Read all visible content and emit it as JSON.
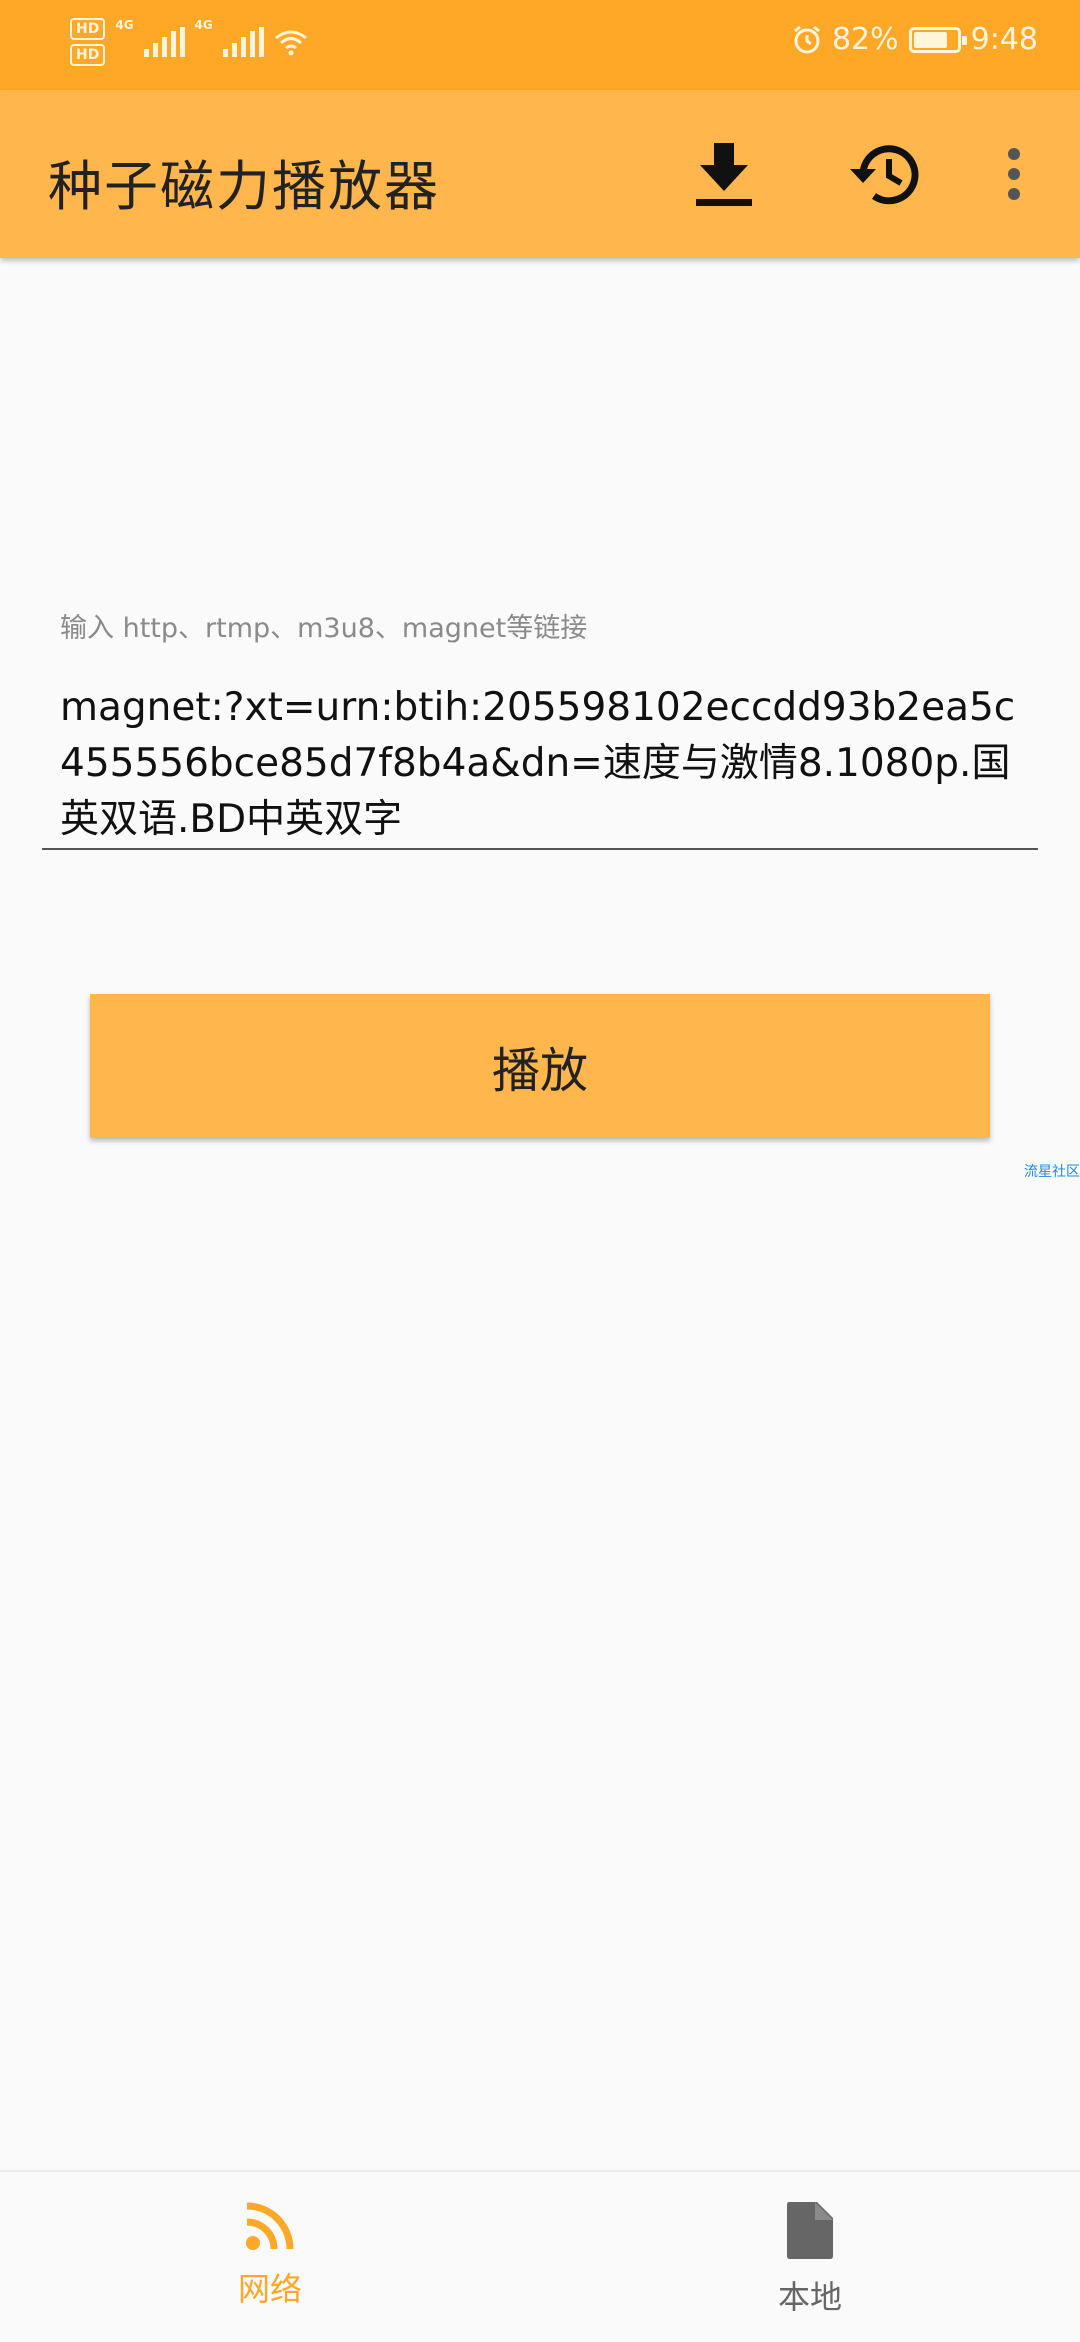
{
  "status_bar": {
    "hd1": "HD",
    "hd2": "HD",
    "net1": "4G",
    "net2": "4G",
    "battery_percent": "82%",
    "battery_level": 0.82,
    "time": "9:48",
    "icons": [
      "signal-icon",
      "wifi-icon",
      "alarm-icon",
      "battery-icon"
    ]
  },
  "app_bar": {
    "title": "种子磁力播放器",
    "actions": [
      "download-icon",
      "history-icon",
      "more-vert-icon"
    ]
  },
  "url_input": {
    "label": "输入 http、rtmp、m3u8、magnet等链接",
    "value": "magnet:?xt=urn:btih:205598102eccdd93b2ea5c455556bce85d7f8b4a&dn=速度与激情8.1080p.国英双语.BD中英双字"
  },
  "play_button": {
    "label": "播放"
  },
  "forum_link": "流星社区",
  "bottom_nav": {
    "items": [
      {
        "label": "网络",
        "icon": "rss-feed-icon",
        "active": true
      },
      {
        "label": "本地",
        "icon": "file-icon",
        "active": false
      }
    ]
  },
  "colors": {
    "status_bar": "#ffa726",
    "app_bar": "#ffb74d",
    "accent": "#ffa726",
    "background": "#fafafa"
  }
}
